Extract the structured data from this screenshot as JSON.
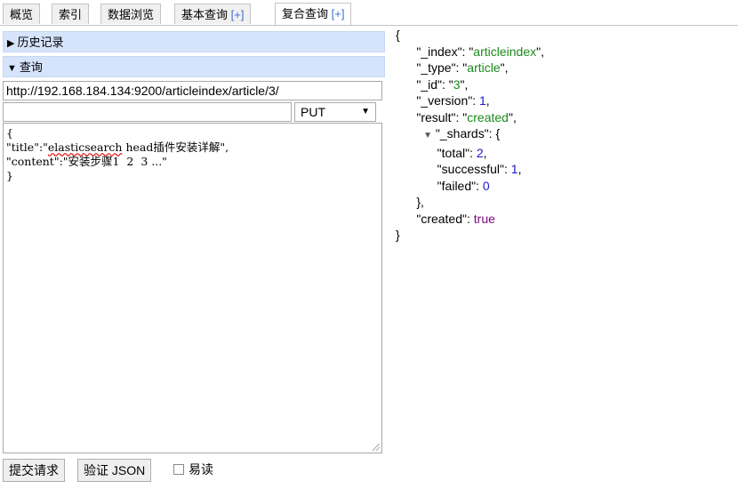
{
  "tabs": [
    {
      "label": "概览",
      "plus": ""
    },
    {
      "label": "索引",
      "plus": ""
    },
    {
      "label": "数据浏览",
      "plus": ""
    },
    {
      "label": "基本查询 ",
      "plus": "[+]"
    },
    {
      "label": "复合查询 ",
      "plus": "[+]"
    }
  ],
  "left": {
    "history_label": "历史记录",
    "query_label": "查询",
    "url": "http://192.168.184.134:9200/articleindex/article/3/",
    "path": "",
    "method": "PUT",
    "body_lines": [
      "{",
      "\"title\":\"",
      "elasticsearch",
      " head插件安装详解\",",
      "\"content\":\"安装步骤1  2  3 ...\"",
      "}"
    ],
    "submit_label": "提交请求",
    "validate_label": "验证 JSON",
    "readable_label": "易读"
  },
  "response": {
    "open": "{",
    "close": "}",
    "shards_close": "},",
    "fields": {
      "index_key": "_index",
      "index_val": "articleindex",
      "type_key": "_type",
      "type_val": "article",
      "id_key": "_id",
      "id_val": "3",
      "version_key": "_version",
      "version_val": "1",
      "result_key": "result",
      "result_val": "created",
      "shards_key": "_shards",
      "total_key": "total",
      "total_val": "2",
      "successful_key": "successful",
      "successful_val": "1",
      "failed_key": "failed",
      "failed_val": "0",
      "created_key": "created",
      "created_val": "true"
    }
  }
}
